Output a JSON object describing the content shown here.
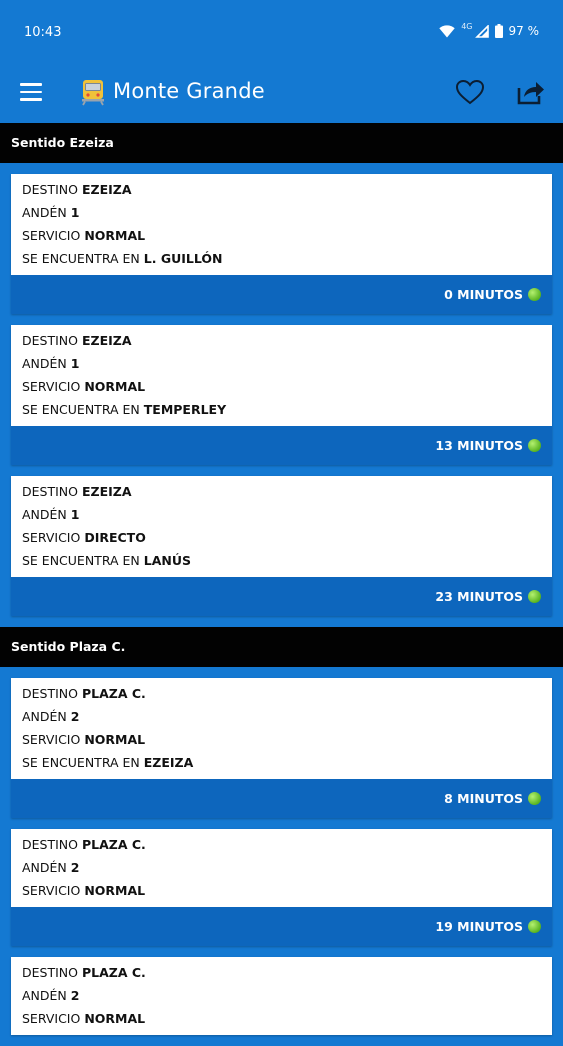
{
  "status": {
    "time": "10:43",
    "network": "4G",
    "battery": "97 %"
  },
  "app": {
    "title": "Monte Grande"
  },
  "sections": [
    {
      "title": "Sentido Ezeiza",
      "cards": [
        {
          "lines": [
            {
              "label": "DESTINO",
              "value": "EZEIZA"
            },
            {
              "label": "ANDÉN",
              "value": "1"
            },
            {
              "label": "SERVICIO",
              "value": "NORMAL"
            },
            {
              "label": "SE ENCUENTRA EN",
              "value": "L. GUILLÓN"
            }
          ],
          "eta": "0 MINUTOS"
        },
        {
          "lines": [
            {
              "label": "DESTINO",
              "value": "EZEIZA"
            },
            {
              "label": "ANDÉN",
              "value": "1"
            },
            {
              "label": "SERVICIO",
              "value": "NORMAL"
            },
            {
              "label": "SE ENCUENTRA EN",
              "value": "TEMPERLEY"
            }
          ],
          "eta": "13 MINUTOS"
        },
        {
          "lines": [
            {
              "label": "DESTINO",
              "value": "EZEIZA"
            },
            {
              "label": "ANDÉN",
              "value": "1"
            },
            {
              "label": "SERVICIO",
              "value": "DIRECTO"
            },
            {
              "label": "SE ENCUENTRA EN",
              "value": "LANÚS"
            }
          ],
          "eta": "23 MINUTOS"
        }
      ]
    },
    {
      "title": "Sentido Plaza C.",
      "cards": [
        {
          "lines": [
            {
              "label": "DESTINO",
              "value": "PLAZA C."
            },
            {
              "label": "ANDÉN",
              "value": "2"
            },
            {
              "label": "SERVICIO",
              "value": "NORMAL"
            },
            {
              "label": "SE ENCUENTRA EN",
              "value": "EZEIZA"
            }
          ],
          "eta": "8 MINUTOS"
        },
        {
          "lines": [
            {
              "label": "DESTINO",
              "value": "PLAZA C."
            },
            {
              "label": "ANDÉN",
              "value": "2"
            },
            {
              "label": "SERVICIO",
              "value": "NORMAL"
            }
          ],
          "eta": "19 MINUTOS"
        },
        {
          "lines": [
            {
              "label": "DESTINO",
              "value": "PLAZA C."
            },
            {
              "label": "ANDÉN",
              "value": "2"
            },
            {
              "label": "SERVICIO",
              "value": "NORMAL"
            }
          ],
          "eta": ""
        }
      ]
    }
  ],
  "colors": {
    "primary": "#1479d2",
    "footer": "#0d66bd",
    "header": "#020202",
    "status_dot": "#59b320"
  },
  "icons": {
    "menu": "hamburger-menu-icon",
    "train": "train-icon",
    "favorite": "heart-outline-icon",
    "share": "share-icon",
    "eta": "green-dot-icon"
  }
}
